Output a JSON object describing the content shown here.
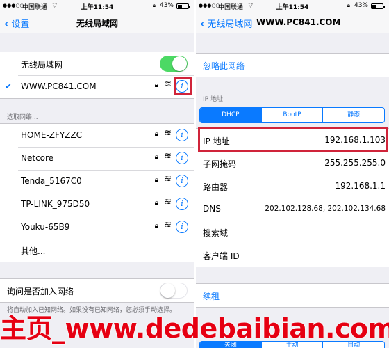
{
  "status_bar": {
    "signal": "●●●○○",
    "carrier": "中国联通",
    "time": "上午11:54",
    "battery": "43%"
  },
  "left": {
    "nav": {
      "back_label": "设置",
      "title": "无线局域网"
    },
    "wifi_toggle": {
      "label": "无线局域网",
      "on": true
    },
    "connected_network": "WWW.PC841.COM",
    "choose_header": "选取网络...",
    "networks": [
      {
        "name": "HOME-ZFYZZC"
      },
      {
        "name": "Netcore"
      },
      {
        "name": "Tenda_5167C0"
      },
      {
        "name": "TP-LINK_975D50"
      },
      {
        "name": "Youku-65B9"
      }
    ],
    "other_label": "其他...",
    "ask_to_join": {
      "label": "询问是否加入网络",
      "on": false
    },
    "footer": "将自动加入已知网络。如果没有已知网络，您必须手动选择。"
  },
  "right": {
    "nav": {
      "back_label": "无线局域网",
      "title": "WWW.PC841.COM"
    },
    "forget_label": "忽略此网络",
    "ip_header": "IP 地址",
    "segments": [
      "DHCP",
      "BootP",
      "静态"
    ],
    "selected_segment": "DHCP",
    "fields": [
      {
        "key": "IP 地址",
        "value": "192.168.1.103"
      },
      {
        "key": "子网掩码",
        "value": "255.255.255.0"
      },
      {
        "key": "路由器",
        "value": "192.168.1.1"
      },
      {
        "key": "DNS",
        "value": "202.102.128.68, 202.102.134.68"
      },
      {
        "key": "搜索域",
        "value": ""
      },
      {
        "key": "客户端 ID",
        "value": ""
      }
    ],
    "renew_label": "续租",
    "bottom_segments": [
      "关闭",
      "手动",
      "自动"
    ],
    "selected_bottom_segment": "关闭"
  },
  "watermark": "主页_www.dedebaibian.com",
  "colors": {
    "accent": "#0a7aff",
    "toggle_on": "#4cd964",
    "highlight": "#d0243a",
    "watermark": "#e60012"
  }
}
